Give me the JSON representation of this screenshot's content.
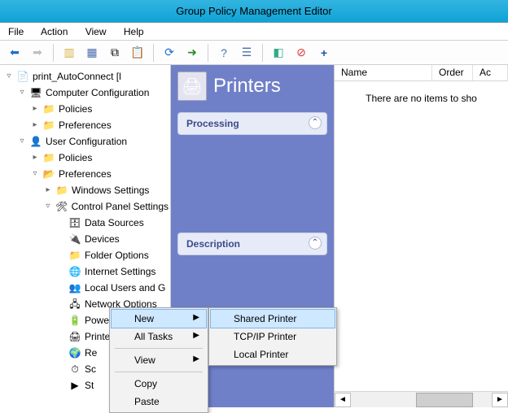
{
  "window": {
    "title": "Group Policy Management Editor"
  },
  "menubar": {
    "file": "File",
    "action": "Action",
    "view": "View",
    "help": "Help"
  },
  "tree": {
    "root": "print_AutoConnect [l",
    "compConf": "Computer Configuration",
    "policies": "Policies",
    "preferences": "Preferences",
    "userConf": "User Configuration",
    "winSettings": "Windows Settings",
    "cpSettings": "Control Panel Settings",
    "cp": {
      "dataSources": "Data Sources",
      "devices": "Devices",
      "folderOptions": "Folder Options",
      "internet": "Internet Settings",
      "localUsers": "Local Users and G",
      "network": "Network Options",
      "power": "Power Options",
      "printers": "Printers",
      "regional": "Re",
      "scheduled": "Sc",
      "start": "St"
    }
  },
  "panel": {
    "heading": "Printers",
    "processing": "Processing",
    "description": "Description"
  },
  "list": {
    "cols": {
      "name": "Name",
      "order": "Order",
      "action": "Ac"
    },
    "empty": "There are no items to sho"
  },
  "ctx1": {
    "new": "New",
    "allTasks": "All Tasks",
    "view": "View",
    "copy": "Copy",
    "paste": "Paste"
  },
  "ctx2": {
    "shared": "Shared Printer",
    "tcpip": "TCP/IP Printer",
    "local": "Local Printer"
  }
}
